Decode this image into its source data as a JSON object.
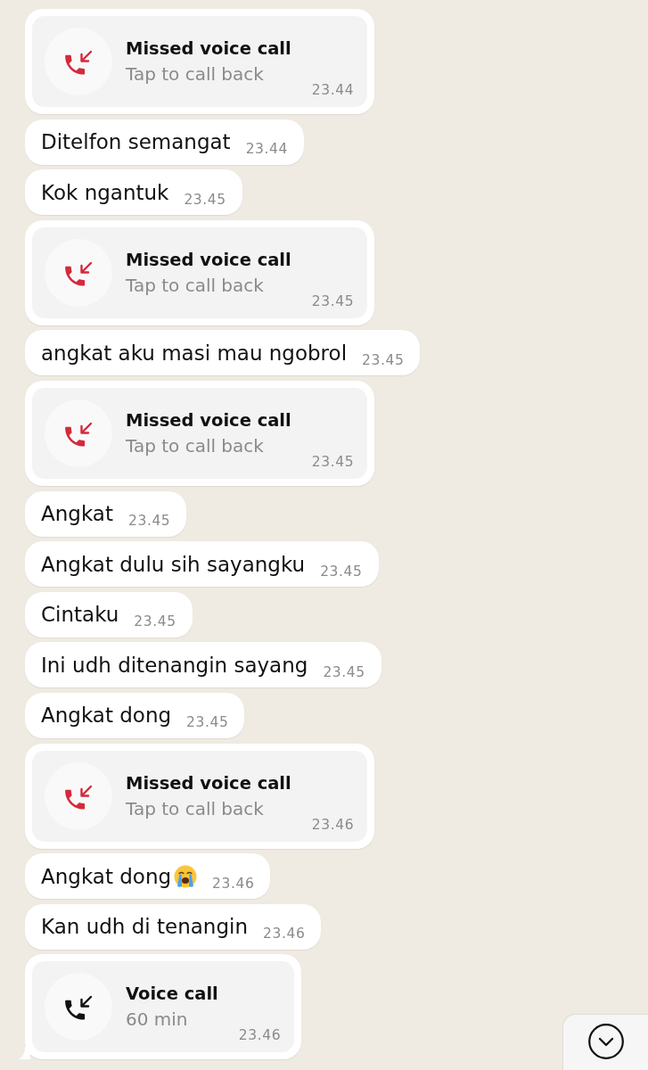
{
  "messages": [
    {
      "kind": "call",
      "missed": true,
      "title": "Missed voice call",
      "subtitle": "Tap to call back",
      "time": "23.44",
      "tail": false
    },
    {
      "kind": "text",
      "text": "Ditelfon semangat",
      "time": "23.44",
      "emoji": false,
      "tail": false
    },
    {
      "kind": "text",
      "text": "Kok ngantuk",
      "time": "23.45",
      "emoji": false,
      "tail": false
    },
    {
      "kind": "call",
      "missed": true,
      "title": "Missed voice call",
      "subtitle": "Tap to call back",
      "time": "23.45",
      "tail": false
    },
    {
      "kind": "text",
      "text": "angkat aku masi mau ngobrol",
      "time": "23.45",
      "emoji": false,
      "tail": false
    },
    {
      "kind": "call",
      "missed": true,
      "title": "Missed voice call",
      "subtitle": "Tap to call back",
      "time": "23.45",
      "tail": false
    },
    {
      "kind": "text",
      "text": "Angkat",
      "time": "23.45",
      "emoji": false,
      "tail": false
    },
    {
      "kind": "text",
      "text": "Angkat dulu sih sayangku",
      "time": "23.45",
      "emoji": false,
      "tail": false
    },
    {
      "kind": "text",
      "text": "Cintaku",
      "time": "23.45",
      "emoji": false,
      "tail": false
    },
    {
      "kind": "text",
      "text": "Ini udh ditenangin sayang",
      "time": "23.45",
      "emoji": false,
      "tail": false
    },
    {
      "kind": "text",
      "text": "Angkat dong",
      "time": "23.45",
      "emoji": false,
      "tail": false
    },
    {
      "kind": "call",
      "missed": true,
      "title": "Missed voice call",
      "subtitle": "Tap to call back",
      "time": "23.46",
      "tail": false
    },
    {
      "kind": "text",
      "text": "Angkat dong",
      "time": "23.46",
      "emoji": true,
      "tail": false
    },
    {
      "kind": "text",
      "text": "Kan udh di tenangin",
      "time": "23.46",
      "emoji": false,
      "tail": false
    },
    {
      "kind": "call",
      "missed": false,
      "title": "Voice call",
      "subtitle": "60 min",
      "time": "23.46",
      "tail": true
    }
  ]
}
